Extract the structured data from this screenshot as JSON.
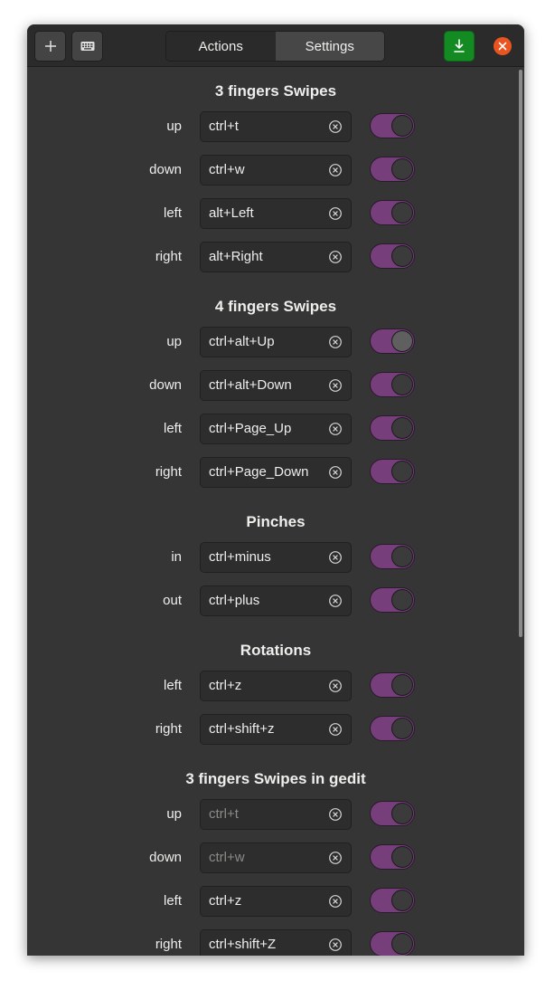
{
  "header": {
    "tabs": [
      {
        "label": "Actions",
        "active": true
      },
      {
        "label": "Settings",
        "active": false
      }
    ],
    "icons": {
      "add": "plus-icon",
      "keyboard": "keyboard-icon",
      "save": "download-icon",
      "close": "close-icon"
    }
  },
  "colors": {
    "accent": "#763e7a",
    "save_button": "#138a22",
    "close_button": "#e95420"
  },
  "sections": [
    {
      "title": "3 fingers Swipes",
      "rows": [
        {
          "label": "up",
          "value": "ctrl+t",
          "enabled": true
        },
        {
          "label": "down",
          "value": "ctrl+w",
          "enabled": true
        },
        {
          "label": "left",
          "value": "alt+Left",
          "enabled": true
        },
        {
          "label": "right",
          "value": "alt+Right",
          "enabled": true
        }
      ]
    },
    {
      "title": "4 fingers Swipes",
      "rows": [
        {
          "label": "up",
          "value": "ctrl+alt+Up",
          "enabled": true
        },
        {
          "label": "down",
          "value": "ctrl+alt+Down",
          "enabled": true
        },
        {
          "label": "left",
          "value": "ctrl+Page_Up",
          "enabled": true
        },
        {
          "label": "right",
          "value": "ctrl+Page_Down",
          "enabled": true
        }
      ]
    },
    {
      "title": "Pinches",
      "rows": [
        {
          "label": "in",
          "value": "ctrl+minus",
          "enabled": true
        },
        {
          "label": "out",
          "value": "ctrl+plus",
          "enabled": true
        }
      ]
    },
    {
      "title": "Rotations",
      "rows": [
        {
          "label": "left",
          "value": "ctrl+z",
          "enabled": true
        },
        {
          "label": "right",
          "value": "ctrl+shift+z",
          "enabled": true
        }
      ]
    },
    {
      "title": "3 fingers Swipes in gedit",
      "rows": [
        {
          "label": "up",
          "value": "",
          "placeholder": "ctrl+t",
          "enabled": true
        },
        {
          "label": "down",
          "value": "",
          "placeholder": "ctrl+w",
          "enabled": true
        },
        {
          "label": "left",
          "value": "ctrl+z",
          "enabled": true
        },
        {
          "label": "right",
          "value": "ctrl+shift+Z",
          "enabled": true
        }
      ]
    }
  ]
}
